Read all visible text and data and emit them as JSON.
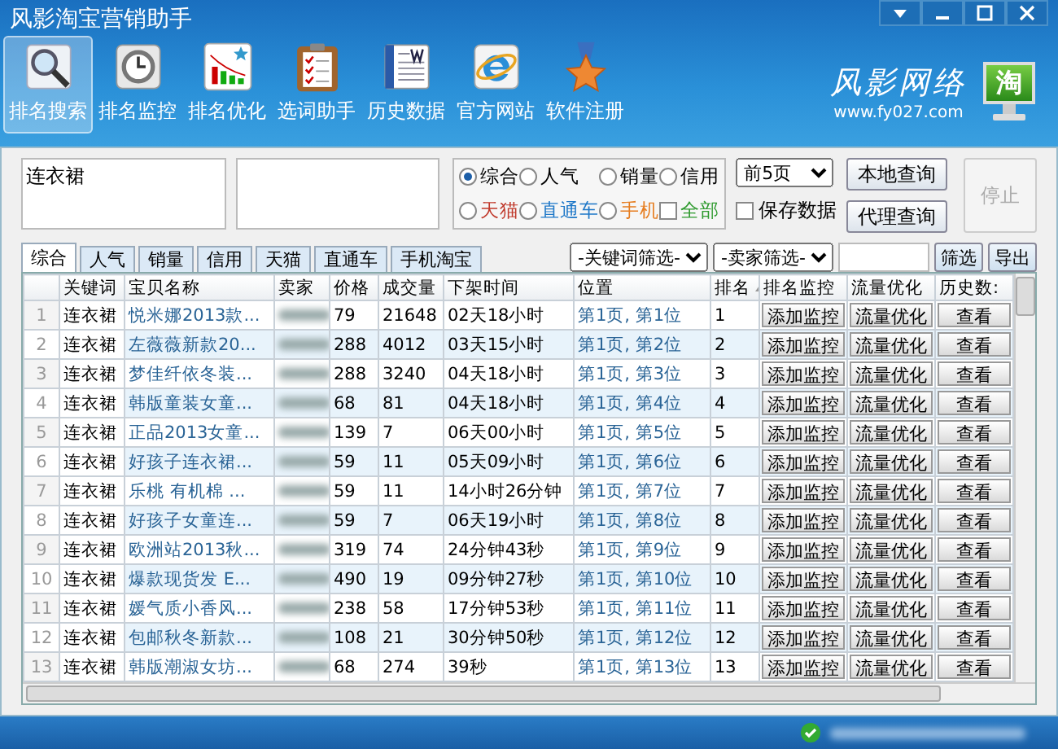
{
  "window": {
    "title": "风影淘宝营销助手"
  },
  "toolbar": [
    {
      "label": "排名搜索",
      "kind": "search",
      "selected": true
    },
    {
      "label": "排名监控",
      "kind": "clock",
      "selected": false
    },
    {
      "label": "排名优化",
      "kind": "chart",
      "selected": false
    },
    {
      "label": "选词助手",
      "kind": "clipboard",
      "selected": false
    },
    {
      "label": "历史数据",
      "kind": "document",
      "selected": false
    },
    {
      "label": "官方网站",
      "kind": "browser",
      "selected": false
    },
    {
      "label": "软件注册",
      "kind": "medal",
      "selected": false
    }
  ],
  "brand": {
    "name": "风影网络",
    "url": "www.fy027.com",
    "badge": "淘"
  },
  "search": {
    "keywords": "连衣裙",
    "options": [
      {
        "label": "综合",
        "kind": "radio",
        "selected": true,
        "color": "#000000"
      },
      {
        "label": "人气",
        "kind": "radio",
        "selected": false,
        "color": "#000000"
      },
      {
        "label": "销量",
        "kind": "radio",
        "selected": false,
        "color": "#000000"
      },
      {
        "label": "信用",
        "kind": "radio",
        "selected": false,
        "color": "#000000"
      },
      {
        "label": "天猫",
        "kind": "radio",
        "selected": false,
        "color": "#c0392b"
      },
      {
        "label": "直通车",
        "kind": "radio",
        "selected": false,
        "color": "#1f78c8"
      },
      {
        "label": "手机",
        "kind": "radio",
        "selected": false,
        "color": "#e67e22"
      },
      {
        "label": "全部",
        "kind": "checkbox",
        "selected": false,
        "color": "#2e9a2e"
      }
    ],
    "pages": "前5页",
    "save_data": {
      "label": "保存数据",
      "checked": false
    },
    "buttons": [
      {
        "label": "本地查询",
        "disabled": false
      },
      {
        "label": "代理查询",
        "disabled": false
      }
    ],
    "stop_button": {
      "label": "停止",
      "disabled": true
    }
  },
  "tabs": [
    {
      "label": "综合",
      "selected": true
    },
    {
      "label": "人气",
      "selected": false
    },
    {
      "label": "销量",
      "selected": false
    },
    {
      "label": "信用",
      "selected": false
    },
    {
      "label": "天猫",
      "selected": false
    },
    {
      "label": "直通车",
      "selected": false
    },
    {
      "label": "手机淘宝",
      "selected": false
    }
  ],
  "filters": {
    "keyword_filter": "-关键词筛选-",
    "seller_filter": "-卖家筛选-",
    "filter_button": "筛选",
    "export_button": "导出"
  },
  "table": {
    "columns": [
      "关键词",
      "宝贝名称",
      "卖家",
      "价格",
      "成交量",
      "下架时间",
      "位置",
      "排名",
      "排名监控",
      "流量优化",
      "历史数:"
    ],
    "rows": [
      {
        "index": "1",
        "keyword": "连衣裙",
        "name": "悦米娜2013款...",
        "price": "79",
        "sales": "21648",
        "time": "02天18小时",
        "position": "第1页, 第1位",
        "rank": "1",
        "monitor": "添加监控",
        "optimize": "流量优化",
        "history": "查看"
      },
      {
        "index": "2",
        "keyword": "连衣裙",
        "name": "左薇薇新款20...",
        "price": "288",
        "sales": "4012",
        "time": "03天15小时",
        "position": "第1页, 第2位",
        "rank": "2",
        "monitor": "添加监控",
        "optimize": "流量优化",
        "history": "查看"
      },
      {
        "index": "3",
        "keyword": "连衣裙",
        "name": "梦佳纤依冬装...",
        "price": "288",
        "sales": "3240",
        "time": "04天18小时",
        "position": "第1页, 第3位",
        "rank": "3",
        "monitor": "添加监控",
        "optimize": "流量优化",
        "history": "查看"
      },
      {
        "index": "4",
        "keyword": "连衣裙",
        "name": "韩版童装女童...",
        "price": "68",
        "sales": "81",
        "time": "04天18小时",
        "position": "第1页, 第4位",
        "rank": "4",
        "monitor": "添加监控",
        "optimize": "流量优化",
        "history": "查看"
      },
      {
        "index": "5",
        "keyword": "连衣裙",
        "name": "正品2013女童...",
        "price": "139",
        "sales": "7",
        "time": "06天00小时",
        "position": "第1页, 第5位",
        "rank": "5",
        "monitor": "添加监控",
        "optimize": "流量优化",
        "history": "查看"
      },
      {
        "index": "6",
        "keyword": "连衣裙",
        "name": "好孩子连衣裙...",
        "price": "59",
        "sales": "11",
        "time": "05天09小时",
        "position": "第1页, 第6位",
        "rank": "6",
        "monitor": "添加监控",
        "optimize": "流量优化",
        "history": "查看"
      },
      {
        "index": "7",
        "keyword": "连衣裙",
        "name": "乐桃 有机棉 ...",
        "price": "59",
        "sales": "11",
        "time": "14小时26分钟",
        "position": "第1页, 第7位",
        "rank": "7",
        "monitor": "添加监控",
        "optimize": "流量优化",
        "history": "查看"
      },
      {
        "index": "8",
        "keyword": "连衣裙",
        "name": "好孩子女童连...",
        "price": "59",
        "sales": "7",
        "time": "06天19小时",
        "position": "第1页, 第8位",
        "rank": "8",
        "monitor": "添加监控",
        "optimize": "流量优化",
        "history": "查看"
      },
      {
        "index": "9",
        "keyword": "连衣裙",
        "name": "欧洲站2013秋...",
        "price": "319",
        "sales": "74",
        "time": "24分钟43秒",
        "position": "第1页, 第9位",
        "rank": "9",
        "monitor": "添加监控",
        "optimize": "流量优化",
        "history": "查看"
      },
      {
        "index": "10",
        "keyword": "连衣裙",
        "name": "爆款现货发 E...",
        "price": "490",
        "sales": "19",
        "time": "09分钟27秒",
        "position": "第1页, 第10位",
        "rank": "10",
        "monitor": "添加监控",
        "optimize": "流量优化",
        "history": "查看"
      },
      {
        "index": "11",
        "keyword": "连衣裙",
        "name": "媛气质小香风...",
        "price": "238",
        "sales": "58",
        "time": "17分钟53秒",
        "position": "第1页, 第11位",
        "rank": "11",
        "monitor": "添加监控",
        "optimize": "流量优化",
        "history": "查看"
      },
      {
        "index": "12",
        "keyword": "连衣裙",
        "name": "包邮秋冬新款...",
        "price": "108",
        "sales": "21",
        "time": "30分钟50秒",
        "position": "第1页, 第12位",
        "rank": "12",
        "monitor": "添加监控",
        "optimize": "流量优化",
        "history": "查看"
      },
      {
        "index": "13",
        "keyword": "连衣裙",
        "name": "韩版潮淑女坊...",
        "price": "68",
        "sales": "274",
        "time": "39秒",
        "position": "第1页, 第13位",
        "rank": "13",
        "monitor": "添加监控",
        "optimize": "流量优化",
        "history": "查看"
      }
    ]
  }
}
